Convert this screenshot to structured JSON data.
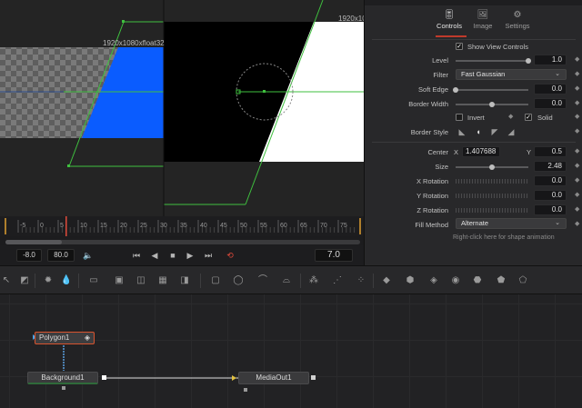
{
  "viewer": {
    "left_res": "1920x1080xfloat32",
    "right_res": "1920x10"
  },
  "ruler": {
    "ticks": [
      "-5",
      "0",
      "5",
      "10",
      "15",
      "20",
      "25",
      "30",
      "35",
      "40",
      "45",
      "50",
      "55",
      "60",
      "65",
      "70",
      "75"
    ]
  },
  "transport": {
    "start": "-8.0",
    "end": "80.0",
    "current_frame": "7.0",
    "scrub_position_fraction": 0.16
  },
  "inspector": {
    "tabs": [
      {
        "label": "Controls",
        "icon": "sliders-icon"
      },
      {
        "label": "Image",
        "icon": "image-icon"
      },
      {
        "label": "Settings",
        "icon": "gear-icon"
      }
    ],
    "show_view_controls": "Show View Controls",
    "level": {
      "label": "Level",
      "value": "1.0",
      "fraction": 1.0
    },
    "filter": {
      "label": "Filter",
      "value": "Fast Gaussian"
    },
    "soft_edge": {
      "label": "Soft Edge",
      "value": "0.0",
      "fraction": 0.0
    },
    "border_width": {
      "label": "Border Width",
      "value": "0.0",
      "fraction": 0.5
    },
    "invert": "Invert",
    "solid": "Solid",
    "border_style": "Border Style",
    "center": {
      "label": "Center",
      "x_label": "X",
      "x_value": "1.407688",
      "y_label": "Y",
      "y_value": "0.5"
    },
    "size": {
      "label": "Size",
      "value": "2.48"
    },
    "x_rotation": {
      "label": "X Rotation",
      "value": "0.0"
    },
    "y_rotation": {
      "label": "Y Rotation",
      "value": "0.0"
    },
    "z_rotation": {
      "label": "Z Rotation",
      "value": "0.0"
    },
    "fill_method": {
      "label": "Fill Method",
      "value": "Alternate"
    },
    "hint": "Right-click here for shape animation"
  },
  "nodes": {
    "polygon": "Polygon1",
    "background": "Background1",
    "mediaout": "MediaOut1"
  },
  "colors": {
    "accent": "#c03a2b",
    "shape_blue": "#0a5cff",
    "polyline_green": "#3fbf3f",
    "playhead": "#e0a030"
  }
}
